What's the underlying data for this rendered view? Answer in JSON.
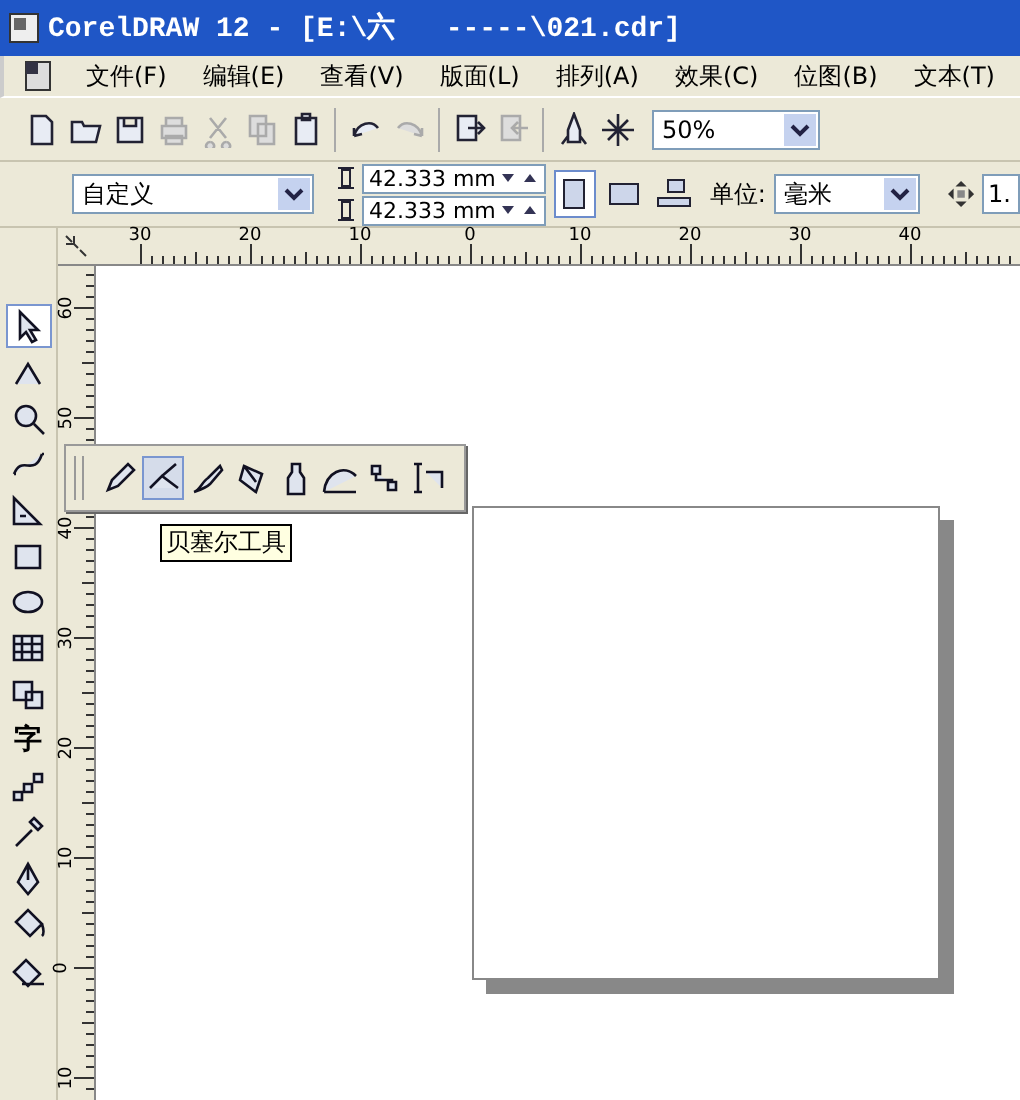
{
  "window": {
    "title": "CorelDRAW 12 - [E:\\六   -----\\021.cdr]"
  },
  "menu": [
    "文件(F)",
    "编辑(E)",
    "查看(V)",
    "版面(L)",
    "排列(A)",
    "效果(C)",
    "位图(B)",
    "文本(T)"
  ],
  "toolbar": {
    "buttons": [
      {
        "disabled": false
      },
      {
        "disabled": false
      },
      {
        "disabled": false
      },
      {
        "disabled": true
      },
      {
        "disabled": true
      },
      {
        "disabled": true
      },
      {
        "disabled": false
      },
      {
        "disabled": false
      },
      {
        "disabled": true
      },
      {
        "disabled": false
      },
      {
        "disabled": true
      },
      {
        "disabled": false
      },
      {
        "disabled": false
      }
    ],
    "zoom": "50%"
  },
  "property_bar": {
    "paper": "自定义",
    "width": "42.333 mm",
    "height": "42.333 mm",
    "orientation": [
      {
        "selected": true
      },
      {
        "selected": false
      }
    ],
    "unit_label": "单位:",
    "unit": "毫米",
    "nudge": "1."
  },
  "rulers": {
    "horizontal": [
      "30",
      "20",
      "10",
      "0",
      "10",
      "20",
      "30",
      "40"
    ],
    "vertical": [
      "60",
      "50",
      "40",
      "30",
      "20",
      "10",
      "0",
      "10"
    ]
  },
  "toolbox": [
    {
      "selected": true
    },
    {
      "selected": false
    },
    {
      "selected": false
    },
    {
      "selected": false
    },
    {
      "selected": false
    },
    {
      "selected": false
    },
    {
      "selected": false
    },
    {
      "selected": false
    },
    {
      "selected": false
    },
    {
      "selected": false,
      "glyph": "字"
    },
    {
      "selected": false
    },
    {
      "selected": false
    },
    {
      "selected": false
    },
    {
      "selected": false
    },
    {
      "selected": false
    }
  ],
  "flyout": {
    "tools": [
      {
        "selected": false
      },
      {
        "selected": true
      },
      {
        "selected": false
      },
      {
        "selected": false
      },
      {
        "selected": false
      },
      {
        "selected": false
      },
      {
        "selected": false
      },
      {
        "selected": false
      }
    ],
    "tooltip": "贝塞尔工具"
  }
}
